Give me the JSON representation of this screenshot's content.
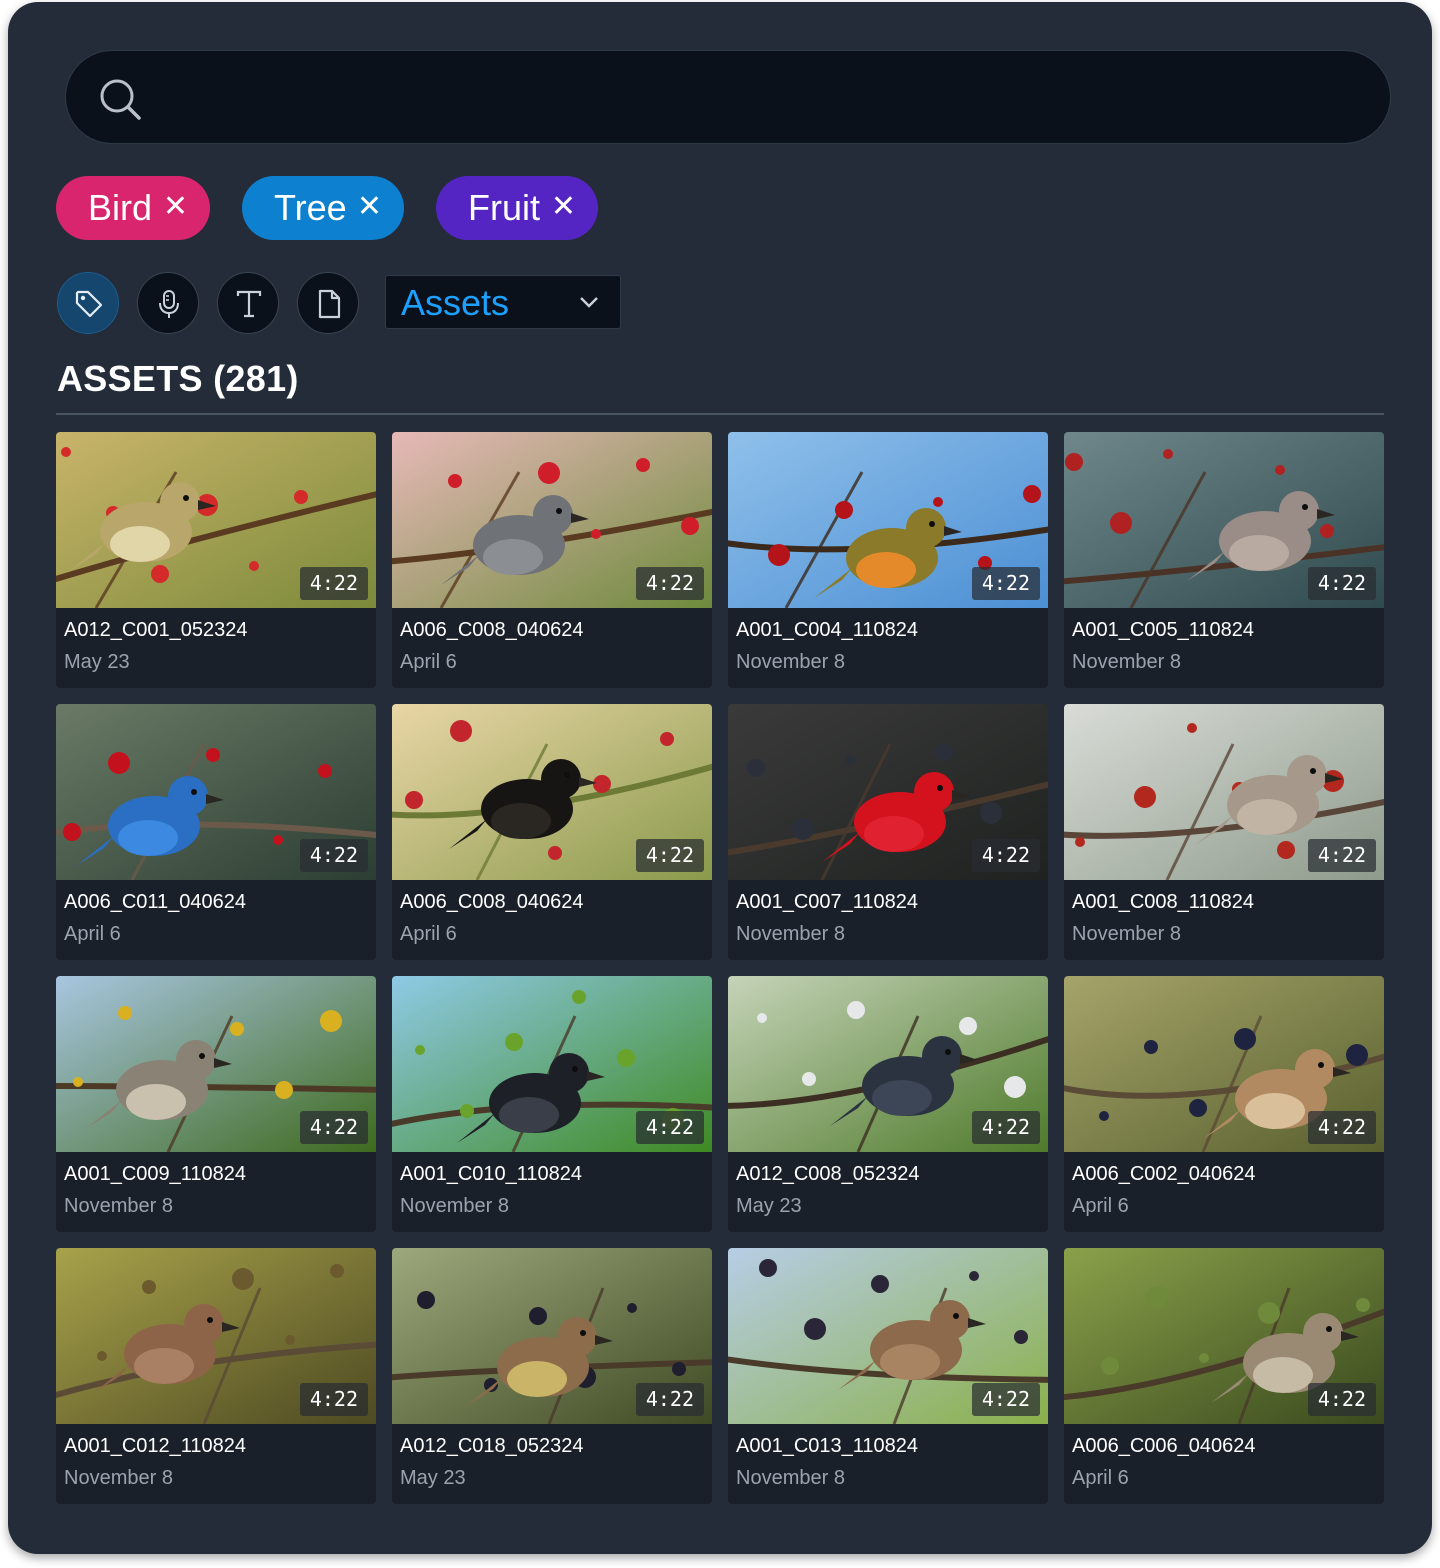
{
  "search": {
    "placeholder": "",
    "value": ""
  },
  "chips": [
    {
      "label": "Bird",
      "color": "#d8256e"
    },
    {
      "label": "Tree",
      "color": "#0d80d0"
    },
    {
      "label": "Fruit",
      "color": "#5525c4"
    }
  ],
  "toolbar": {
    "tools": [
      "tag-icon",
      "microphone-icon",
      "text-icon",
      "document-icon"
    ],
    "selected_value": "Assets",
    "accent": "#1ea0ff"
  },
  "section": {
    "title": "ASSETS (281)"
  },
  "assets": [
    {
      "name": "A012_C001_052324",
      "date": "May 23",
      "duration": "4:22",
      "scene": "finch-berries"
    },
    {
      "name": "A006_C008_040624",
      "date": "April 6",
      "duration": "4:22",
      "scene": "catbird-blossom"
    },
    {
      "name": "A001_C004_110824",
      "date": "November 8",
      "duration": "4:22",
      "scene": "robin-sky"
    },
    {
      "name": "A001_C005_110824",
      "date": "November 8",
      "duration": "4:22",
      "scene": "waxwing-branch"
    },
    {
      "name": "A006_C011_040624",
      "date": "April 6",
      "duration": "4:22",
      "scene": "jay-apples"
    },
    {
      "name": "A006_C008_040624",
      "date": "April 6",
      "duration": "4:22",
      "scene": "blackbird-moss"
    },
    {
      "name": "A001_C007_110824",
      "date": "November 8",
      "duration": "4:22",
      "scene": "cardinal-dark"
    },
    {
      "name": "A001_C008_110824",
      "date": "November 8",
      "duration": "4:22",
      "scene": "waxwing-berries"
    },
    {
      "name": "A001_C009_110824",
      "date": "November 8",
      "duration": "4:22",
      "scene": "woodpecker-tree"
    },
    {
      "name": "A001_C010_110824",
      "date": "November 8",
      "duration": "4:22",
      "scene": "starling-leaves"
    },
    {
      "name": "A012_C008_052324",
      "date": "May 23",
      "duration": "4:22",
      "scene": "grackle-green"
    },
    {
      "name": "A006_C002_040624",
      "date": "April 6",
      "duration": "4:22",
      "scene": "cedar-waxwing-berry"
    },
    {
      "name": "A001_C012_110824",
      "date": "November 8",
      "duration": "4:22",
      "scene": "cedar-waxwing-portrait"
    },
    {
      "name": "A012_C018_052324",
      "date": "May 23",
      "duration": "4:22",
      "scene": "cedar-waxwing-side"
    },
    {
      "name": "A001_C013_110824",
      "date": "November 8",
      "duration": "4:22",
      "scene": "cedar-waxwing-sky"
    },
    {
      "name": "A006_C006_040624",
      "date": "April 6",
      "duration": "4:22",
      "scene": "flycatcher-bush"
    }
  ]
}
